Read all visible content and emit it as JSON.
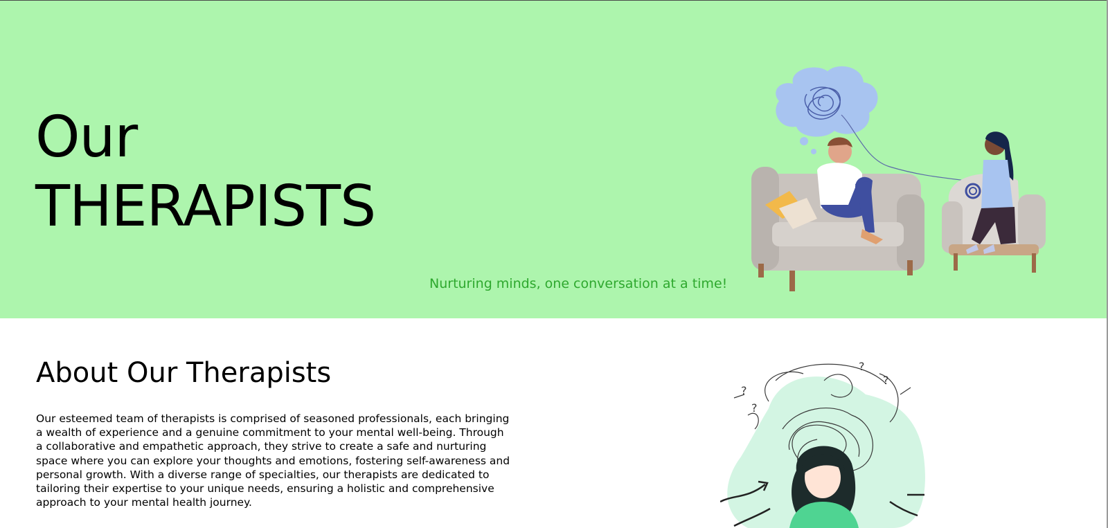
{
  "hero": {
    "title_line1": "Our",
    "title_line2": "THERAPISTS",
    "tagline": "Nurturing minds, one conversation at a time!"
  },
  "about": {
    "title": "About Our Therapists",
    "body": "Our esteemed team of therapists is comprised of seasoned professionals, each bringing a wealth of experience and a genuine commitment to your mental well-being. Through a collaborative and empathetic approach, they strive to create a safe and nurturing space where you can explore your thoughts and emotions, fostering self-awareness and personal growth. With a diverse range of specialties, our therapists are dedicated to tailoring their expertise to your unique needs, ensuring a holistic and comprehensive approach to your mental health journey."
  },
  "colors": {
    "hero_background": "#adf5ad",
    "tagline": "#2ea82e",
    "text": "#000000"
  },
  "illustrations": {
    "hero": "therapy-session-illustration",
    "about": "anxious-woman-illustration"
  }
}
